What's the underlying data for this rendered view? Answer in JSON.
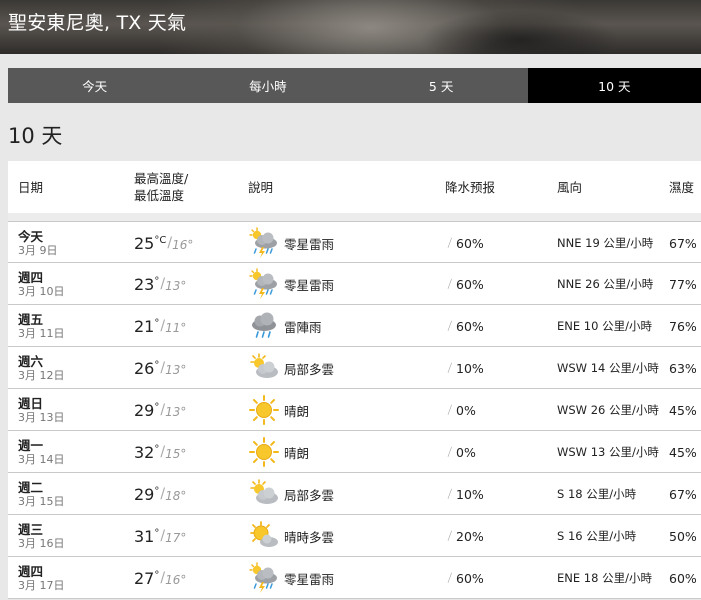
{
  "header": {
    "title": "聖安東尼奧, TX 天氣"
  },
  "tabs": [
    {
      "label": "今天",
      "active": false
    },
    {
      "label": "每小時",
      "active": false
    },
    {
      "label": "5 天",
      "active": false
    },
    {
      "label": "10 天",
      "active": true
    }
  ],
  "section_title": "10 天",
  "columns": {
    "date": "日期",
    "temp_line1": "最高溫度/",
    "temp_line2": "最低溫度",
    "desc": "說明",
    "precip": "降水预报",
    "wind": "風向",
    "humidity": "濕度"
  },
  "rows": [
    {
      "day": "今天",
      "date": "3月 9日",
      "high": "25",
      "high_unit": "°C",
      "low": "16°",
      "icon": "thunderstorm-icon",
      "desc": "零星雷雨",
      "precip": "60%",
      "wind": "NNE 19 公里/小時",
      "humidity": "67%"
    },
    {
      "day": "週四",
      "date": "3月 10日",
      "high": "23",
      "high_unit": "°",
      "low": "13°",
      "icon": "thunderstorm-icon",
      "desc": "零星雷雨",
      "precip": "60%",
      "wind": "NNE 26 公里/小時",
      "humidity": "77%"
    },
    {
      "day": "週五",
      "date": "3月 11日",
      "high": "21",
      "high_unit": "°",
      "low": "11°",
      "icon": "shower-icon",
      "desc": "雷陣雨",
      "precip": "60%",
      "wind": "ENE 10 公里/小時",
      "humidity": "76%"
    },
    {
      "day": "週六",
      "date": "3月 12日",
      "high": "26",
      "high_unit": "°",
      "low": "13°",
      "icon": "partly-cloudy-icon",
      "desc": "局部多雲",
      "precip": "10%",
      "wind": "WSW 14 公里/小時",
      "humidity": "63%"
    },
    {
      "day": "週日",
      "date": "3月 13日",
      "high": "29",
      "high_unit": "°",
      "low": "13°",
      "icon": "sunny-icon",
      "desc": "晴朗",
      "precip": "0%",
      "wind": "WSW 26 公里/小時",
      "humidity": "45%"
    },
    {
      "day": "週一",
      "date": "3月 14日",
      "high": "32",
      "high_unit": "°",
      "low": "15°",
      "icon": "sunny-icon",
      "desc": "晴朗",
      "precip": "0%",
      "wind": "WSW 13 公里/小時",
      "humidity": "45%"
    },
    {
      "day": "週二",
      "date": "3月 15日",
      "high": "29",
      "high_unit": "°",
      "low": "18°",
      "icon": "partly-cloudy-icon",
      "desc": "局部多雲",
      "precip": "10%",
      "wind": "S 18 公里/小時",
      "humidity": "67%"
    },
    {
      "day": "週三",
      "date": "3月 16日",
      "high": "31",
      "high_unit": "°",
      "low": "17°",
      "icon": "mostly-sunny-icon",
      "desc": "晴時多雲",
      "precip": "20%",
      "wind": "S 16 公里/小時",
      "humidity": "50%"
    },
    {
      "day": "週四",
      "date": "3月 17日",
      "high": "27",
      "high_unit": "°",
      "low": "16°",
      "icon": "thunderstorm-icon",
      "desc": "零星雷雨",
      "precip": "60%",
      "wind": "ENE 18 公里/小時",
      "humidity": "60%"
    }
  ]
}
